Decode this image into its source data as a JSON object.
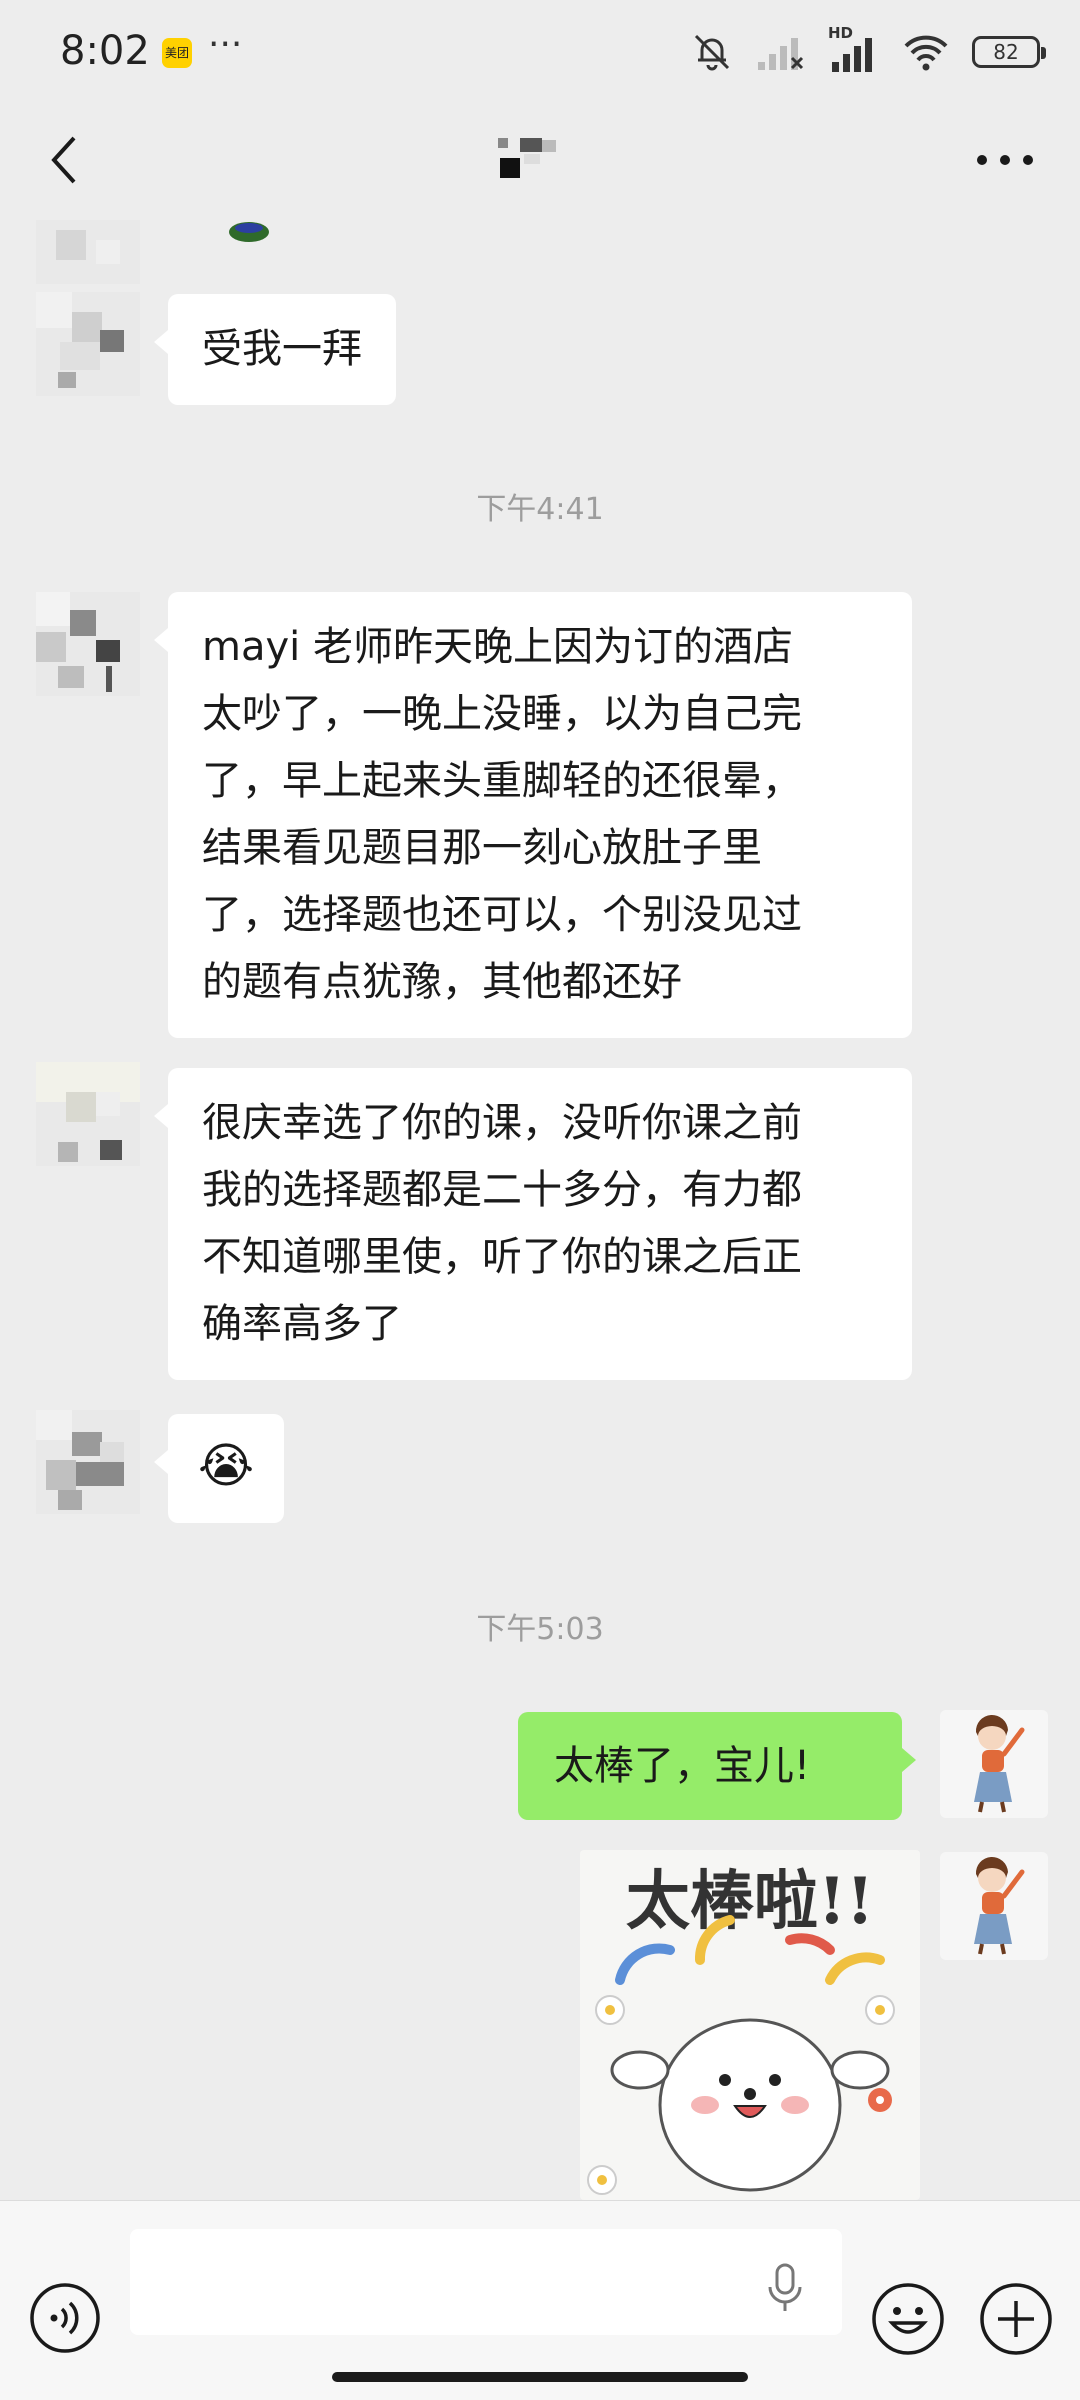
{
  "status_bar": {
    "time": "8:02",
    "app_badge": "美团",
    "more": "···",
    "hd_label": "HD",
    "battery": "82"
  },
  "nav": {
    "back_icon": "chevron-left-icon",
    "more_icon": "more-horizontal-icon"
  },
  "messages": [
    {
      "side": "left",
      "type": "text",
      "text": "受我一拜"
    },
    {
      "type": "timestamp",
      "text": "下午4:41"
    },
    {
      "side": "left",
      "type": "text",
      "lines": [
        "mayi 老师昨天晚上因为订的酒店",
        "太吵了，一晚上没睡，以为自己完",
        "了，早上起来头重脚轻的还很晕，",
        "结果看见题目那一刻心放肚子里",
        "了，选择题也还可以，个别没见过",
        "的题有点犹豫，其他都还好"
      ]
    },
    {
      "side": "left",
      "type": "text",
      "lines": [
        "很庆幸选了你的课，没听你课之前",
        "我的选择题都是二十多分，有力都",
        "不知道哪里使，听了你的课之后正",
        "确率高多了"
      ]
    },
    {
      "side": "left",
      "type": "emoji",
      "text": "😭"
    },
    {
      "type": "timestamp",
      "text": "下午5:03"
    },
    {
      "side": "right",
      "type": "text",
      "text": "太棒了，宝儿!"
    },
    {
      "side": "right",
      "type": "sticker",
      "text": "太棒啦!!"
    }
  ],
  "input_bar": {
    "voice_icon": "voice-input-icon",
    "mic_icon": "microphone-icon",
    "emoji_icon": "emoji-icon",
    "plus_icon": "plus-icon"
  },
  "colors": {
    "background": "#ededed",
    "incoming_bubble": "#ffffff",
    "outgoing_bubble": "#95ec69",
    "timestamp": "#9d9d9d"
  }
}
